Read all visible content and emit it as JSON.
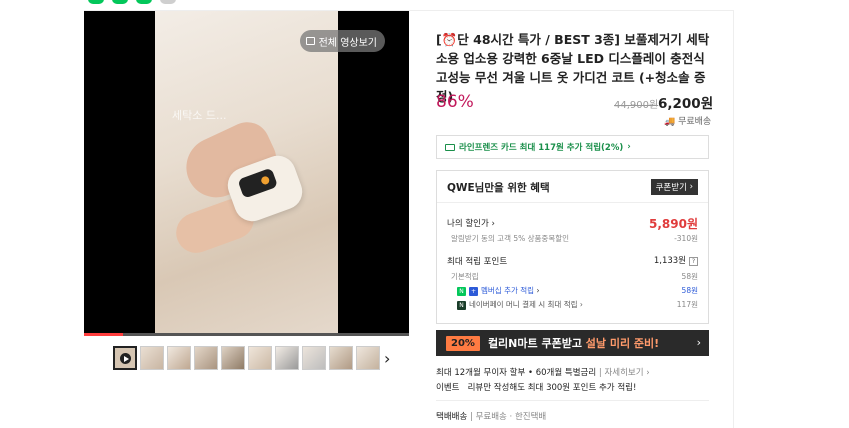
{
  "video": {
    "button_label": "전체 영상보기",
    "overlay_text": "세탁소 드...",
    "progress_percent": 12
  },
  "product": {
    "title_tag": "[",
    "title_icon": "clock-icon",
    "title_text": "단 48시간 특가 / BEST 3종] 보풀제거기 세탁소용 업소용 강력한 6중날 LED 디스플레이 충전식 고성능 무선 겨울 니트 옷 가디건 코트 (+청소솔 증정)",
    "discount_rate": "86%",
    "original_price": "44,900원",
    "price": "6,200원",
    "shipping": "무료배송"
  },
  "card_promo": {
    "label": "라인프렌즈 카드 최대 117원 추가 적립(2%)",
    "arrow": "›"
  },
  "benefit": {
    "title": "QWE님만을 위한 혜택",
    "coupon_button": "쿠폰받기",
    "my_discount_label": "나의 할인가",
    "my_discount_value": "5,890원",
    "my_discount_note": "알림받기 동의 고객 5% 상품중복할인",
    "my_discount_note_value": "-310원",
    "points_label": "최대 적립 포인트",
    "points_value": "1,133원",
    "basic_label": "기본적립",
    "basic_value": "58원",
    "membership_label": "멤버십 추가 적립",
    "membership_value": "58원",
    "naverpay_label": "네이버페이 머니 결제 시 최대 적립",
    "naverpay_value": "117원"
  },
  "banner": {
    "percent": "20%",
    "text_main": "컬리N마트 쿠폰받고 ",
    "text_highlight": "설날 미리 준비!",
    "arrow": "›"
  },
  "info": {
    "installment": "최대 12개월 무이자 할부 • 60개월 특별금리",
    "installment_link": "자세히보기",
    "event_label": "이벤트",
    "event_text": "리뷰만 작성해도 최대 300원 포인트 추가 적립!",
    "delivery_label": "택배배송",
    "delivery_free": "무료배송",
    "delivery_company": "한진택배"
  },
  "colors": {
    "discount": "#c2185b",
    "accent_red": "#e03c3c",
    "naver_green": "#03c75a",
    "banner_bg": "#2a2a2a",
    "banner_badge": "#ff7b42"
  }
}
